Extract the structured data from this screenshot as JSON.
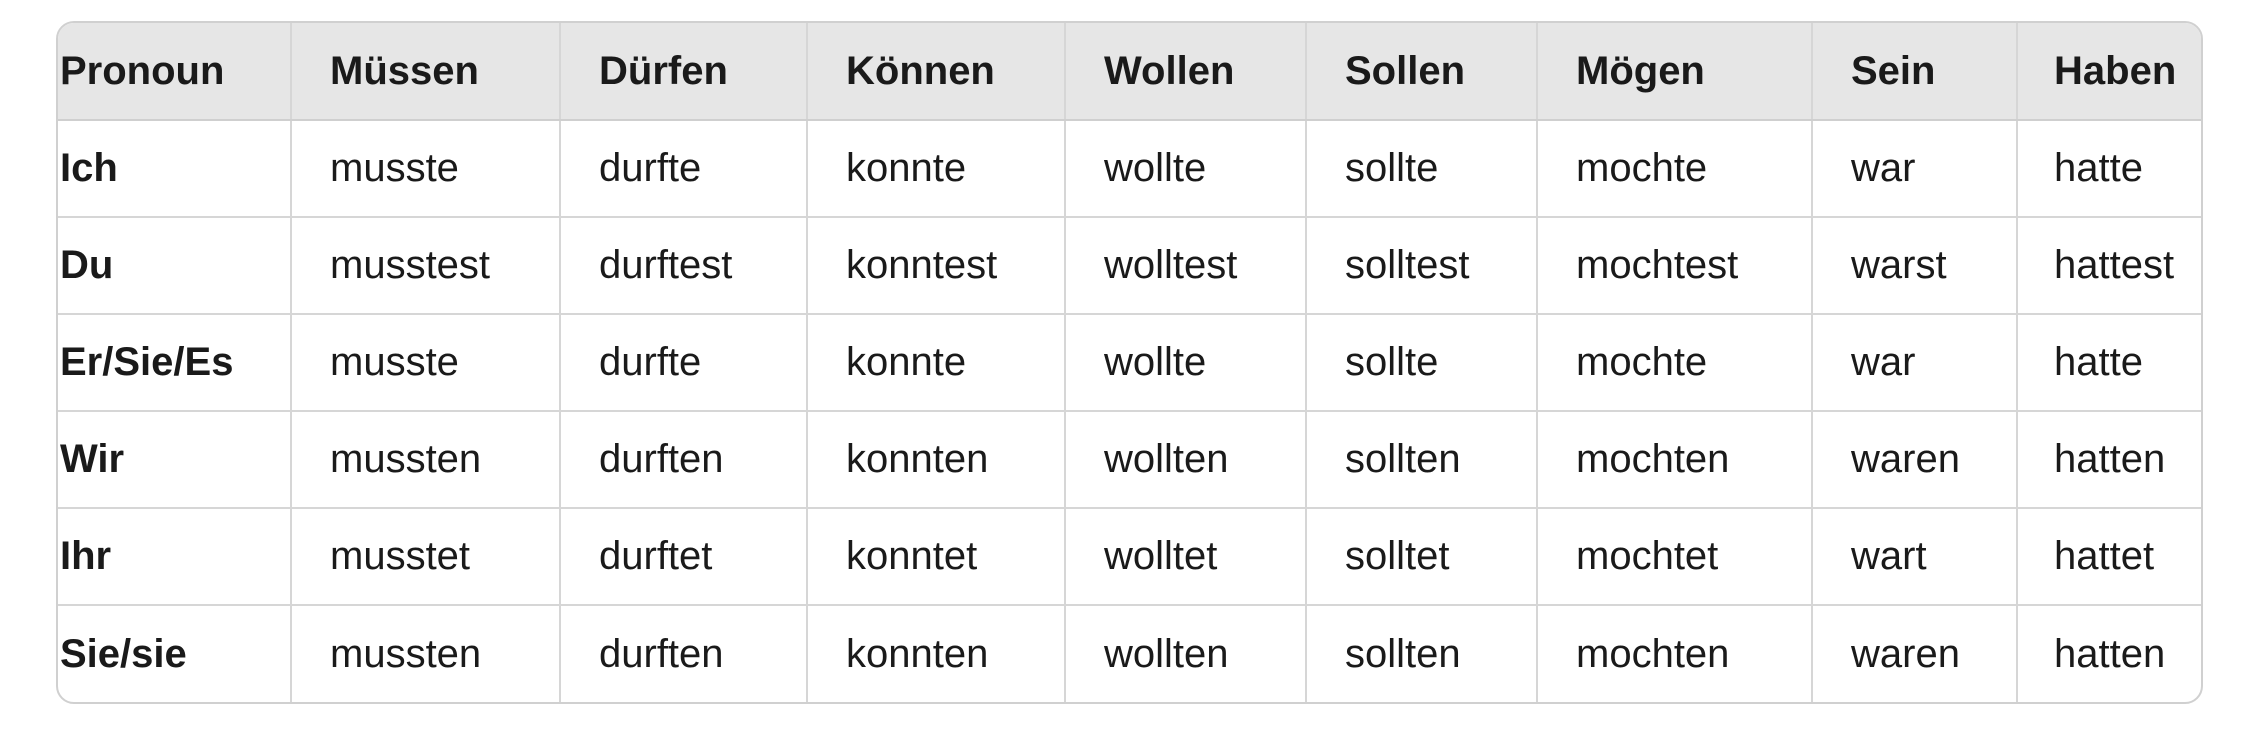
{
  "table": {
    "headers": [
      "Pronoun",
      "Müssen",
      "Dürfen",
      "Können",
      "Wollen",
      "Sollen",
      "Mögen",
      "Sein",
      "Haben"
    ],
    "rows": [
      [
        "Ich",
        "musste",
        "durfte",
        "konnte",
        "wollte",
        "sollte",
        "mochte",
        "war",
        "hatte"
      ],
      [
        "Du",
        "musstest",
        "durftest",
        "konntest",
        "wolltest",
        "solltest",
        "mochtest",
        "warst",
        "hattest"
      ],
      [
        "Er/Sie/Es",
        "musste",
        "durfte",
        "konnte",
        "wollte",
        "sollte",
        "mochte",
        "war",
        "hatte"
      ],
      [
        "Wir",
        "mussten",
        "durften",
        "konnten",
        "wollten",
        "sollten",
        "mochten",
        "waren",
        "hatten"
      ],
      [
        "Ihr",
        "musstet",
        "durftet",
        "konntet",
        "wolltet",
        "solltet",
        "mochtet",
        "wart",
        "hattet"
      ],
      [
        "Sie/sie",
        "mussten",
        "durften",
        "konnten",
        "wollten",
        "sollten",
        "mochten",
        "waren",
        "hatten"
      ]
    ]
  },
  "colors": {
    "header_background": "#e6e6e6",
    "border": "#d6d6d6",
    "text": "#1a1a1a"
  }
}
